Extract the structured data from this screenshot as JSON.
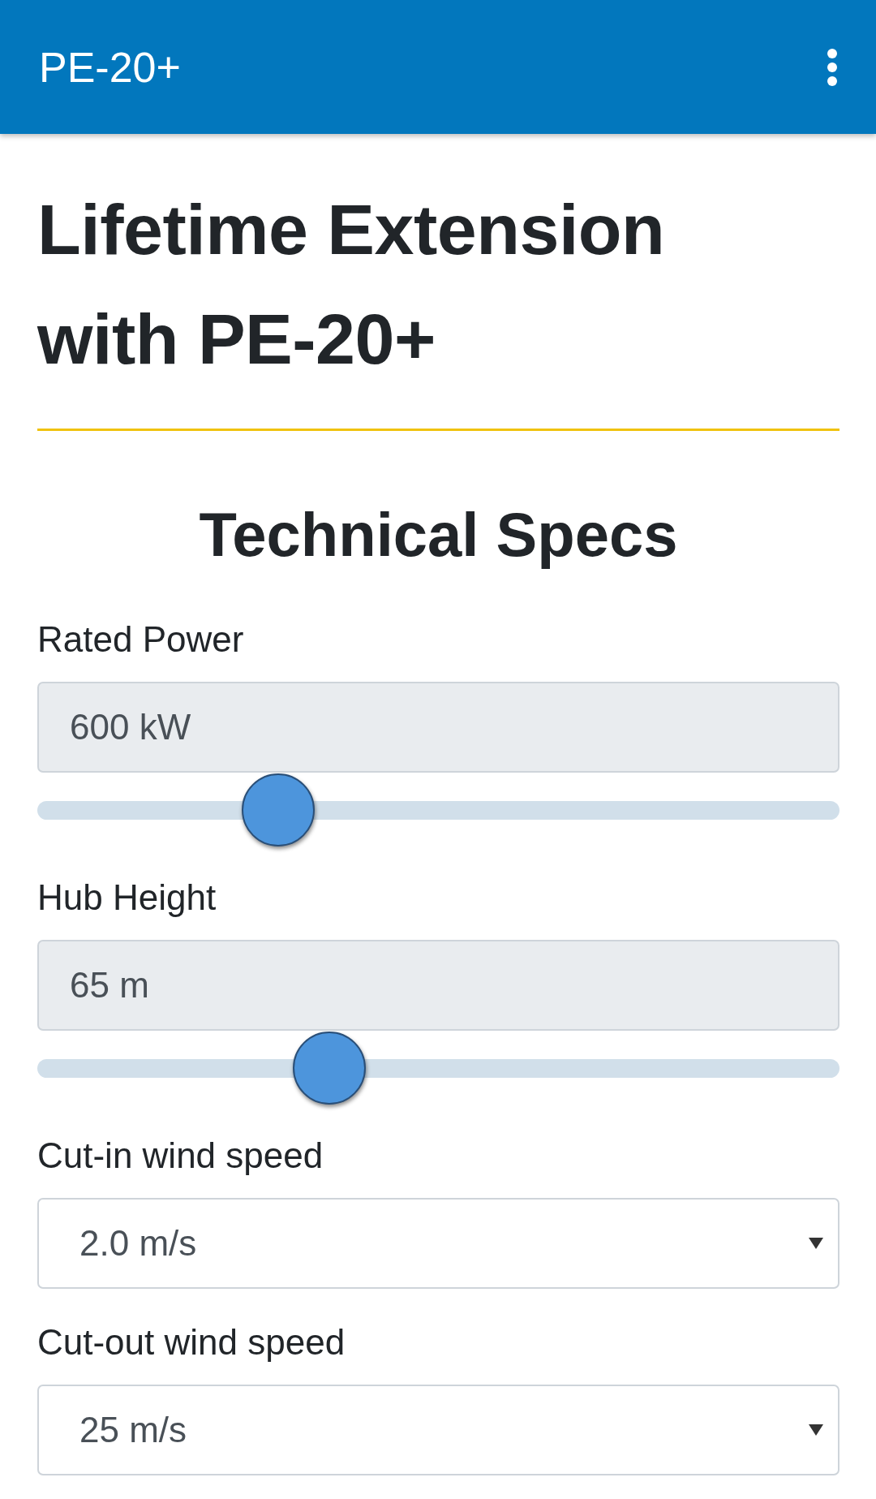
{
  "app_bar": {
    "title": "PE-20+"
  },
  "heading": "Lifetime Extension with PE-20+",
  "section_title": "Technical Specs",
  "fields": [
    {
      "kind": "slider",
      "label": "Rated Power",
      "value": "600 kW",
      "level": 0.28
    },
    {
      "kind": "slider",
      "label": "Hub Height",
      "value": "65 m",
      "level": 0.35
    },
    {
      "kind": "select",
      "label": "Cut-in wind speed",
      "value": "2.0 m/s"
    },
    {
      "kind": "select",
      "label": "Cut-out wind speed",
      "value": "25 m/s"
    }
  ]
}
